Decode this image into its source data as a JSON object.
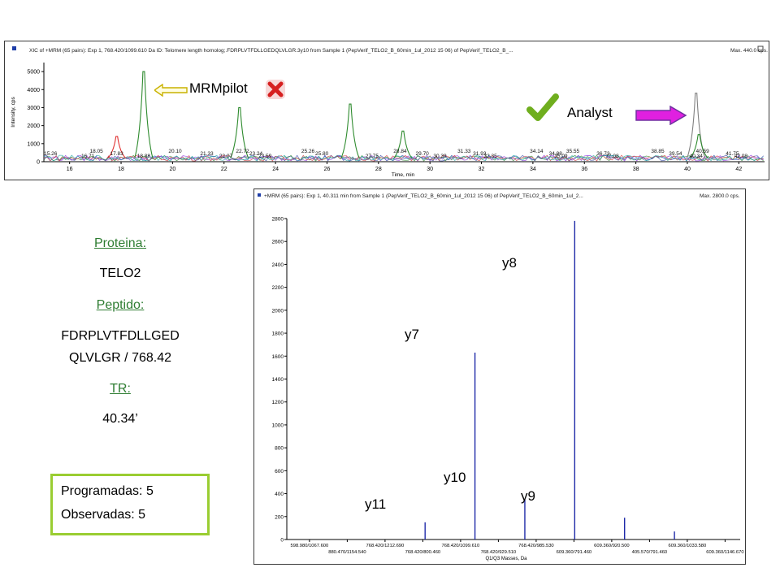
{
  "top_chart": {
    "header": "XIC of +MRM (65 pairs): Exp 1, 768.420/1099.610 Da ID: Telomere length homolog;.FDRPLVTFDLLGEDQLVLGR.3y10 from Sample 1 (PepVerif_TELO2_B_60min_1ul_2012 15 06) of PepVerif_TELO2_B_...",
    "max_label": "Max. 440.0 cps.",
    "ylabel": "Intensity, cps",
    "xlabel": "Time, min",
    "mrmpilot_label": "MRMpilot",
    "analyst_label": "Analyst"
  },
  "left_info": {
    "protein_label": "Proteina:",
    "protein_value": "TELO2",
    "peptide_label": "Peptido:",
    "peptide_line1": "FDRPLVTFDLLGED",
    "peptide_line2": "QLVLGR  / 768.42",
    "tr_label": "TR:",
    "tr_value": "40.34’",
    "programadas": "Programadas: 5",
    "observadas": "Observadas: 5"
  },
  "bottom_chart": {
    "header": "+MRM (65 pairs): Exp 1, 40.311 min from Sample 1 (PepVerif_TELO2_B_60min_1ul_2012 15 06) of PepVerif_TELO2_B_60min_1ul_2...",
    "max_label": "Max. 2800.0 cps.",
    "xlabel": "Q1/Q3 Masses, Da",
    "ion_labels": [
      "y11",
      "y7",
      "y10",
      "y8",
      "y9"
    ]
  },
  "chart_data": [
    {
      "type": "line",
      "title": "XIC of +MRM (65 pairs)",
      "xlabel": "Time, min",
      "ylabel": "Intensity, cps",
      "xlim": [
        15,
        43
      ],
      "ylim": [
        0,
        5500
      ],
      "xticks": [
        16,
        18,
        20,
        22,
        24,
        26,
        28,
        30,
        32,
        34,
        36,
        38,
        40,
        42
      ],
      "yticks": [
        0,
        1000,
        2000,
        3000,
        4000,
        5000
      ],
      "peak_labels": [
        {
          "x": 15.26,
          "label": "15.26"
        },
        {
          "x": 16.71,
          "label": "16.71"
        },
        {
          "x": 17.04,
          "label": "18.05"
        },
        {
          "x": 17.83,
          "label": "17.83"
        },
        {
          "x": 18.88,
          "label": "18.88"
        },
        {
          "x": 20.1,
          "label": "20.10"
        },
        {
          "x": 21.33,
          "label": "21.33"
        },
        {
          "x": 22.07,
          "label": "22.07"
        },
        {
          "x": 22.72,
          "label": "22.72"
        },
        {
          "x": 23.24,
          "label": "23.24"
        },
        {
          "x": 23.59,
          "label": "23.59"
        },
        {
          "x": 25.26,
          "label": "25.26"
        },
        {
          "x": 25.8,
          "label": "25.80"
        },
        {
          "x": 27.75,
          "label": "27.75"
        },
        {
          "x": 28.84,
          "label": "28.84"
        },
        {
          "x": 29.7,
          "label": "29.70"
        },
        {
          "x": 30.39,
          "label": "30.39"
        },
        {
          "x": 31.33,
          "label": "31.33"
        },
        {
          "x": 31.93,
          "label": "31.93"
        },
        {
          "x": 32.35,
          "label": "32.35"
        },
        {
          "x": 34.14,
          "label": "34.14"
        },
        {
          "x": 34.88,
          "label": "34.88"
        },
        {
          "x": 35.09,
          "label": "35.09"
        },
        {
          "x": 35.55,
          "label": "35.55"
        },
        {
          "x": 36.73,
          "label": "36.73"
        },
        {
          "x": 37.08,
          "label": "37.08"
        },
        {
          "x": 38.85,
          "label": "38.85"
        },
        {
          "x": 39.54,
          "label": "39.54"
        },
        {
          "x": 40.34,
          "label": "40.34"
        },
        {
          "x": 40.59,
          "label": "40.59"
        },
        {
          "x": 41.75,
          "label": "41.75"
        },
        {
          "x": 42.08,
          "label": "42.08"
        }
      ],
      "peaks": [
        {
          "x": 18.88,
          "y": 5000,
          "color": "#2e8b2e"
        },
        {
          "x": 22.6,
          "y": 3000,
          "color": "#2e8b2e"
        },
        {
          "x": 26.9,
          "y": 3200,
          "color": "#2e8b2e"
        },
        {
          "x": 17.83,
          "y": 1400,
          "color": "#e03030"
        },
        {
          "x": 28.95,
          "y": 1700,
          "color": "#2e8b2e"
        },
        {
          "x": 40.34,
          "y": 3800,
          "color": "#808080"
        },
        {
          "x": 40.45,
          "y": 1500,
          "color": "#2e8b2e"
        }
      ]
    },
    {
      "type": "bar",
      "title": "+MRM (65 pairs): Exp 1, 40.311 min",
      "xlabel": "Q1/Q3 Masses, Da",
      "ylabel": "",
      "ylim": [
        0,
        2800
      ],
      "yticks": [
        0,
        200,
        400,
        600,
        800,
        1000,
        1200,
        1400,
        1600,
        1800,
        2000,
        2200,
        2400,
        2600,
        2800
      ],
      "categories_top": [
        "598.980/1067.600",
        "768.420/1212.690",
        "768.420/1099.610",
        "768.420/985.530",
        "609.360/920.500",
        "609.360/1033.580"
      ],
      "categories_bottom": [
        "880.470/1154.540",
        "768.420/800.460",
        "768.420/929.510",
        "609.360/791.460",
        "405.570/791.460",
        "609.360/1146.670"
      ],
      "bars": [
        {
          "label": "y11",
          "x": 0.305,
          "value": 150
        },
        {
          "label": "y7",
          "x": 0.415,
          "value": 1630
        },
        {
          "label": "y10",
          "x": 0.525,
          "value": 350
        },
        {
          "label": "y8",
          "x": 0.635,
          "value": 2780
        },
        {
          "label": "y9",
          "x": 0.745,
          "value": 190
        },
        {
          "label": "",
          "x": 0.855,
          "value": 70
        }
      ],
      "color": "#1f2aa8"
    }
  ]
}
